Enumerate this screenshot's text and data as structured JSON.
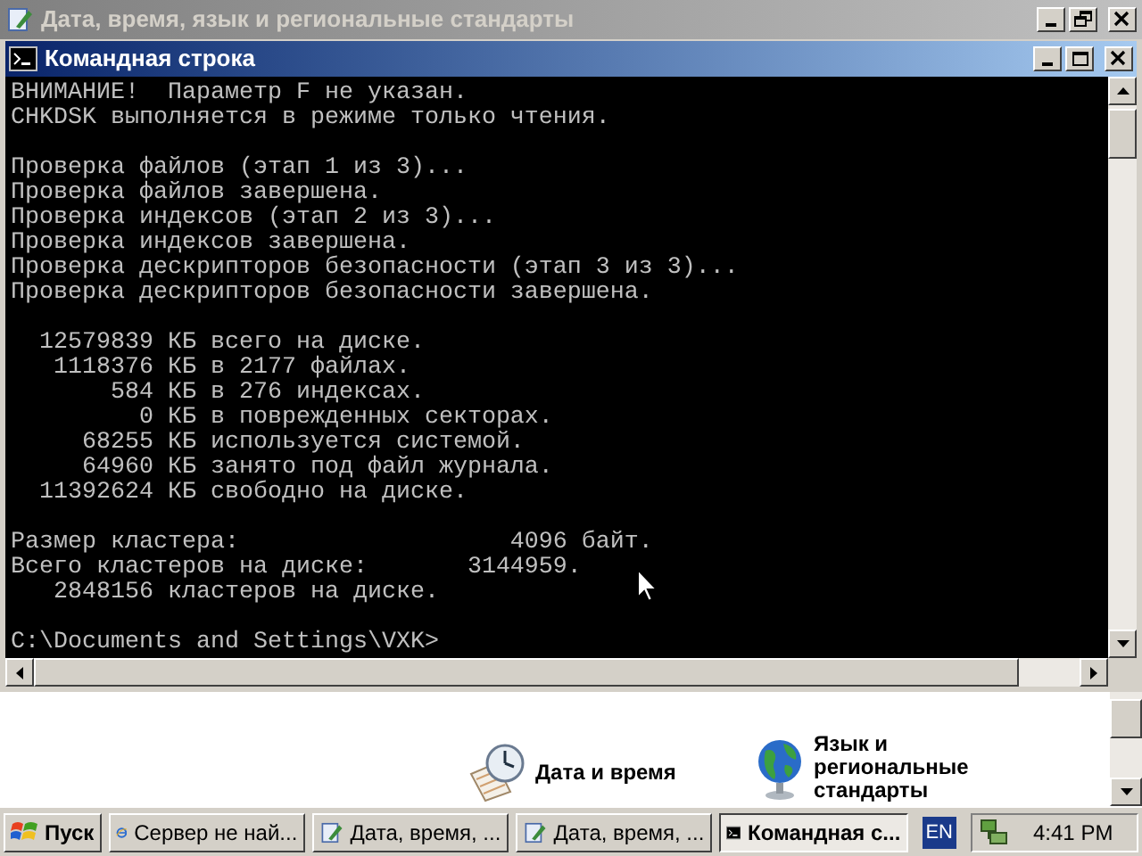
{
  "background_window": {
    "title": "Дата, время, язык и региональные стандарты"
  },
  "console_window": {
    "title": "Командная строка",
    "output_blocks": [
      [
        "ВНИМАНИЕ!  Параметр F не указан.",
        "CHKDSK выполняется в режиме только чтения."
      ],
      [
        "Проверка файлов (этап 1 из 3)...",
        "Проверка файлов завершена.",
        "Проверка индексов (этап 2 из 3)...",
        "Проверка индексов завершена.",
        "Проверка дескрипторов безопасности (этап 3 из 3)...",
        "Проверка дескрипторов безопасности завершена."
      ],
      [
        "  12579839 КБ всего на диске.",
        "   1118376 КБ в 2177 файлах.",
        "       584 КБ в 276 индексах.",
        "         0 КБ в поврежденных секторах.",
        "     68255 КБ используется системой.",
        "     64960 КБ занято под файл журнала.",
        "  11392624 КБ свободно на диске."
      ],
      [
        "Размер кластера:                   4096 байт.",
        "Всего кластеров на диске:       3144959.",
        "   2848156 кластеров на диске."
      ],
      [
        "C:\\Documents and Settings\\VXK>"
      ]
    ]
  },
  "control_panel": {
    "items": [
      {
        "label": "Дата и время",
        "kind": "clock"
      },
      {
        "label": "Язык и региональные стандарты",
        "kind": "globe"
      }
    ]
  },
  "taskbar": {
    "start_label": "Пуск",
    "buttons": [
      {
        "label": "Сервер не най...",
        "kind": "browser",
        "selected": false
      },
      {
        "label": "Дата, время, ...",
        "kind": "control-panel",
        "selected": false
      },
      {
        "label": "Дата, время, ...",
        "kind": "control-panel",
        "selected": false
      },
      {
        "label": "Командная с...",
        "kind": "console",
        "selected": true
      }
    ],
    "language": "EN",
    "clock": "4:41 PM"
  }
}
